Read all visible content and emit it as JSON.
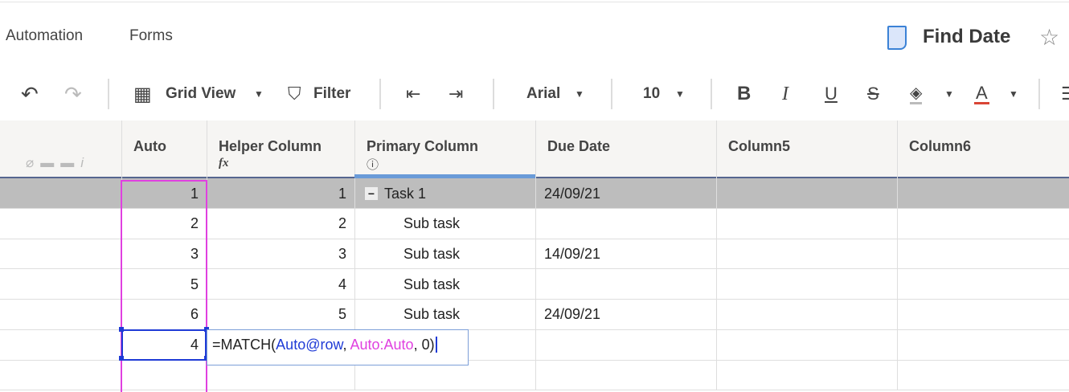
{
  "nav": {
    "items": [
      "Automation",
      "Forms"
    ],
    "sheet_title": "Find Date"
  },
  "toolbar": {
    "view": "Grid View",
    "filter": "Filter",
    "font": "Arial",
    "font_size": "10",
    "bold": "B",
    "italic": "I",
    "underline": "U",
    "strike": "S",
    "text_color": "A"
  },
  "columns": [
    "Auto",
    "Helper Column",
    "Primary Column",
    "Due Date",
    "Column5",
    "Column6"
  ],
  "rows": [
    {
      "auto": "1",
      "helper": "1",
      "primary": "Task 1",
      "due": "24/09/21"
    },
    {
      "auto": "2",
      "helper": "2",
      "primary": "Sub task",
      "due": ""
    },
    {
      "auto": "3",
      "helper": "3",
      "primary": "Sub task",
      "due": "14/09/21"
    },
    {
      "auto": "5",
      "helper": "4",
      "primary": "Sub task",
      "due": ""
    },
    {
      "auto": "6",
      "helper": "5",
      "primary": "Sub task",
      "due": "24/09/21"
    },
    {
      "auto": "4",
      "helper": "",
      "primary": "",
      "due": ""
    }
  ],
  "formula": {
    "prefix": "=MATCH(",
    "arg1": "Auto@row",
    "sep1": ", ",
    "arg2": "Auto:Auto",
    "rest": ", 0)"
  },
  "colors": {
    "accent": "#1f3bd6",
    "range": "#e040e0",
    "selected_row": "#bdbdbd"
  }
}
